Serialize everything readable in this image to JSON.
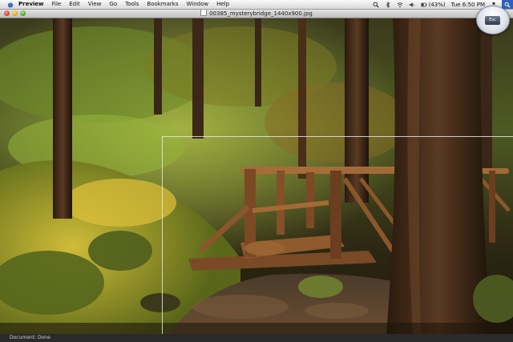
{
  "menubar": {
    "app_name": "Preview",
    "items": [
      "File",
      "Edit",
      "View",
      "Go",
      "Tools",
      "Bookmarks",
      "Window",
      "Help"
    ],
    "battery": "(43%)",
    "clock": "Tue 6:50 PM"
  },
  "window": {
    "title": "00385_mysterybridge_1440x900.jpg"
  },
  "status": {
    "text": "Document: Done"
  },
  "esc_hint": {
    "label": "Esc"
  },
  "icons": [
    "apple-icon",
    "magnifier-icon",
    "bluetooth-icon",
    "wifi-icon",
    "volume-icon",
    "battery-icon",
    "user-icon",
    "spotlight-icon"
  ]
}
